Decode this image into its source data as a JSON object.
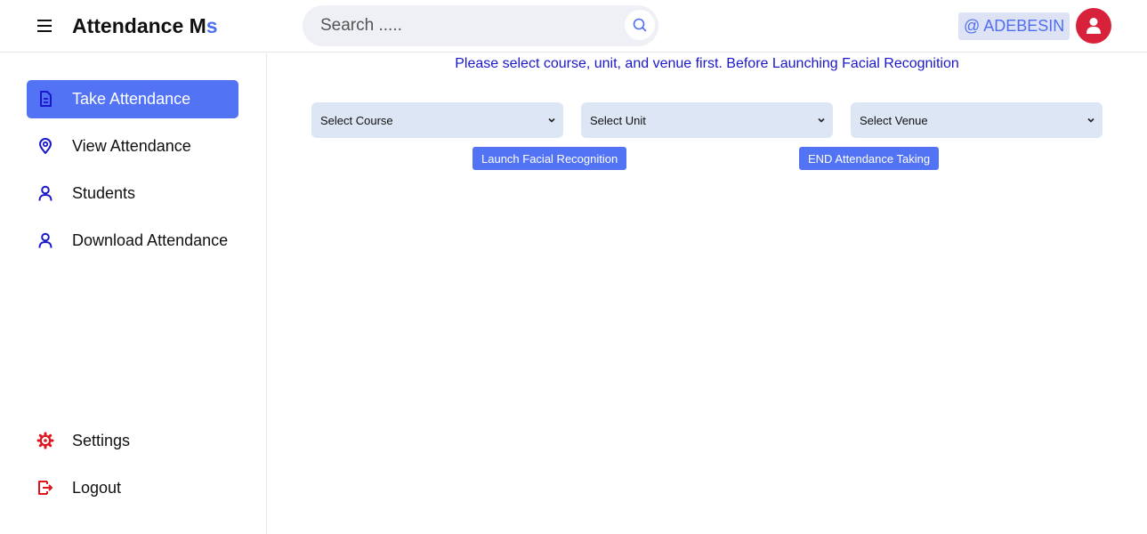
{
  "header": {
    "brand_main": "Attendance M",
    "brand_accent": "s",
    "search_placeholder": "Search .....",
    "user_tag": "@ ADEBESIN"
  },
  "sidebar": {
    "items": [
      {
        "label": "Take Attendance",
        "icon": "document-icon",
        "active": true
      },
      {
        "label": "View Attendance",
        "icon": "location-pin-icon"
      },
      {
        "label": "Students",
        "icon": "user-icon"
      },
      {
        "label": "Download Attendance",
        "icon": "user-icon"
      }
    ],
    "bottom_items": [
      {
        "label": "Settings",
        "icon": "gear-icon"
      },
      {
        "label": "Logout",
        "icon": "logout-icon"
      }
    ]
  },
  "main": {
    "notice": "Please select course, unit, and venue first. Before Launching Facial Recognition",
    "selects": {
      "course": "Select Course",
      "unit": "Select Unit",
      "venue": "Select Venue"
    },
    "buttons": {
      "launch": "Launch Facial Recognition",
      "end": "END Attendance Taking"
    }
  },
  "colors": {
    "accent": "#5273f4",
    "notice_text": "#1a18c9",
    "avatar": "#d8213a",
    "icon_blue": "#1a18c9",
    "icon_red": "#e0141e"
  }
}
